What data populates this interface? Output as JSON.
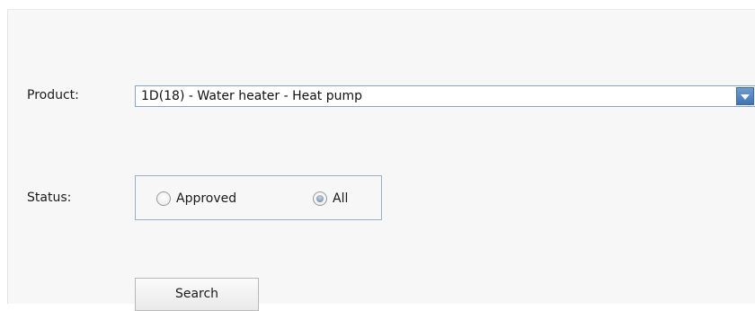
{
  "form": {
    "product_label": "Product:",
    "product_value": "1D(18) - Water heater - Heat pump",
    "status_label": "Status:",
    "status_options": [
      {
        "label": "Approved",
        "selected": false
      },
      {
        "label": "All",
        "selected": true
      }
    ],
    "search_label": "Search"
  },
  "colors": {
    "background": "#f7f7f7",
    "accent": "#3e74b7",
    "border": "#9bb0c7"
  }
}
